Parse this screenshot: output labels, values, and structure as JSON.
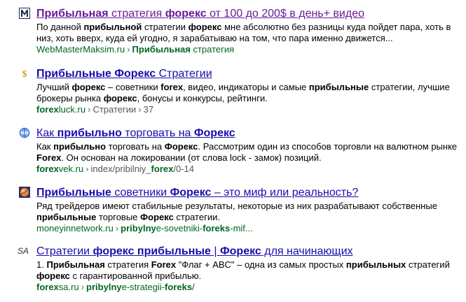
{
  "results": [
    {
      "favicon": "m-letter-icon",
      "title_parts": [
        {
          "t": "Прибыльная",
          "b": true
        },
        {
          "t": " стратегия ",
          "b": false
        },
        {
          "t": "форекс",
          "b": true
        },
        {
          "t": " от 100 до 200$ в день+ видео",
          "b": false
        }
      ],
      "snippet_parts": [
        {
          "t": "По данной ",
          "b": false
        },
        {
          "t": "прибыльной",
          "b": true
        },
        {
          "t": " стратегии ",
          "b": false
        },
        {
          "t": "форекс",
          "b": true
        },
        {
          "t": " мне абсолютно без разницы куда пойдет пара, хоть в низ, хоть вверх, куда ей угодно, я зарабатываю на том, что пара именно движется...",
          "b": false
        }
      ],
      "url_parts": [
        {
          "t": "WebMasterMaksim.ru",
          "style": "host"
        },
        {
          "t": "›",
          "style": "sep"
        },
        {
          "t": "Прибыльная",
          "style": "crumb-bold"
        },
        {
          "t": " стратегия",
          "style": "host"
        }
      ]
    },
    {
      "favicon": "dollar-icon",
      "title_parts": [
        {
          "t": "Прибыльные Форекс",
          "b": true
        },
        {
          "t": " Стратегии",
          "b": false
        }
      ],
      "snippet_parts": [
        {
          "t": "Лучший ",
          "b": false
        },
        {
          "t": "форекс",
          "b": true
        },
        {
          "t": " – советники ",
          "b": false
        },
        {
          "t": "forex",
          "b": true
        },
        {
          "t": ", видео, индикаторы и самые ",
          "b": false
        },
        {
          "t": "прибыльные",
          "b": true
        },
        {
          "t": " стратегии, лучшие брокеры рынка ",
          "b": false
        },
        {
          "t": "форекс",
          "b": true
        },
        {
          "t": ", бонусы и конкурсы, рейтинги.",
          "b": false
        }
      ],
      "url_parts": [
        {
          "t": "forex",
          "style": "host-bold"
        },
        {
          "t": "luck.ru",
          "style": "host"
        },
        {
          "t": "›",
          "style": "sep"
        },
        {
          "t": "Стратегии",
          "style": "crumb"
        },
        {
          "t": "›",
          "style": "sep"
        },
        {
          "t": "37",
          "style": "crumb"
        }
      ]
    },
    {
      "favicon": "globe-blue-icon",
      "title_parts": [
        {
          "t": "Как ",
          "b": false
        },
        {
          "t": "прибыльно",
          "b": true
        },
        {
          "t": " торговать на ",
          "b": false
        },
        {
          "t": "Форекс",
          "b": true
        }
      ],
      "snippet_parts": [
        {
          "t": "Как ",
          "b": false
        },
        {
          "t": "прибыльно",
          "b": true
        },
        {
          "t": " торговать на ",
          "b": false
        },
        {
          "t": "Форекс",
          "b": true
        },
        {
          "t": ". Рассмотрим один из способов торговли на валютном рынке ",
          "b": false
        },
        {
          "t": "Forex",
          "b": true
        },
        {
          "t": ". Он основан на локировании (от слова lock - замок) позиций.",
          "b": false
        }
      ],
      "url_parts": [
        {
          "t": "forex",
          "style": "host-bold"
        },
        {
          "t": "vek.ru",
          "style": "host"
        },
        {
          "t": "›",
          "style": "sep"
        },
        {
          "t": "index/pribilniy_",
          "style": "crumb"
        },
        {
          "t": "forex",
          "style": "crumb-bold"
        },
        {
          "t": "/0-14",
          "style": "crumb"
        }
      ]
    },
    {
      "favicon": "planet-icon",
      "title_parts": [
        {
          "t": "Прибыльные",
          "b": true
        },
        {
          "t": " советники ",
          "b": false
        },
        {
          "t": "Форекс",
          "b": true
        },
        {
          "t": " – это миф или реальность?",
          "b": false
        }
      ],
      "snippet_parts": [
        {
          "t": "Ряд трейдеров имеют стабильные результаты, некоторые из них разрабатывают собственные ",
          "b": false
        },
        {
          "t": "прибыльные",
          "b": true
        },
        {
          "t": " торговые ",
          "b": false
        },
        {
          "t": "Форекс",
          "b": true
        },
        {
          "t": " стратегии.",
          "b": false
        }
      ],
      "url_parts": [
        {
          "t": "moneyinnetwork.ru",
          "style": "host"
        },
        {
          "t": "›",
          "style": "sep"
        },
        {
          "t": "pribylny",
          "style": "crumb-bold"
        },
        {
          "t": "e-sovetniki-",
          "style": "host"
        },
        {
          "t": "foreks",
          "style": "crumb-bold"
        },
        {
          "t": "-mif...",
          "style": "host"
        }
      ]
    },
    {
      "favicon": "sa-text-icon",
      "favicon_text": "SA",
      "title_parts": [
        {
          "t": "Стратегии ",
          "b": false
        },
        {
          "t": "форекс прибыльные",
          "b": true
        },
        {
          "t": " | ",
          "b": false
        },
        {
          "t": "Форекс",
          "b": true
        },
        {
          "t": " для начинающих",
          "b": false
        }
      ],
      "snippet_parts": [
        {
          "t": "1. ",
          "b": false
        },
        {
          "t": "Прибыльная",
          "b": true
        },
        {
          "t": " стратегия ",
          "b": false
        },
        {
          "t": "Forex",
          "b": true
        },
        {
          "t": " \"Флаг + ABC\" – одна из самых простых ",
          "b": false
        },
        {
          "t": "прибыльных",
          "b": true
        },
        {
          "t": " стратегий ",
          "b": false
        },
        {
          "t": "форекс",
          "b": true
        },
        {
          "t": " с гарантированной прибылью.",
          "b": false
        }
      ],
      "url_parts": [
        {
          "t": "forex",
          "style": "host-bold"
        },
        {
          "t": "sa.ru",
          "style": "host"
        },
        {
          "t": "›",
          "style": "sep"
        },
        {
          "t": "pribylny",
          "style": "crumb-bold"
        },
        {
          "t": "e-strategii-",
          "style": "host"
        },
        {
          "t": "foreks",
          "style": "crumb-bold"
        },
        {
          "t": "/",
          "style": "host"
        }
      ]
    }
  ],
  "colors": {
    "title": "#1a0dab",
    "url": "#006621",
    "text": "#000000"
  }
}
